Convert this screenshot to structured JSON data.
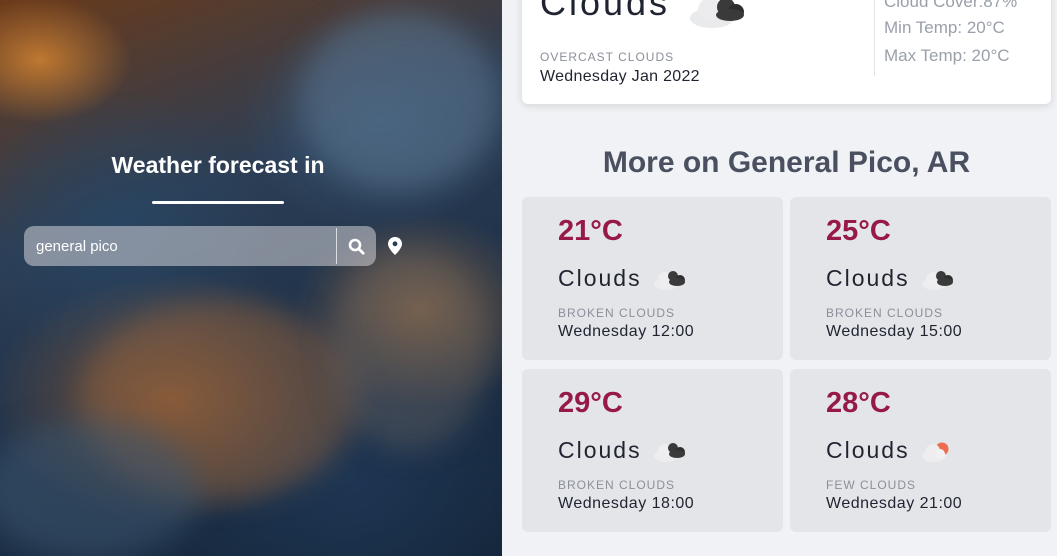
{
  "hero": {
    "title": "Weather forecast in",
    "search_value": "general pico"
  },
  "current": {
    "condition": "Clouds",
    "description": "OVERCAST CLOUDS",
    "date": "Wednesday Jan 2022",
    "cloud_cover": "Cloud Cover:87%",
    "min_temp": "Min Temp: 20°C",
    "max_temp": "Max Temp: 20°C",
    "icon": "overcast-clouds-icon"
  },
  "section_title": "More on General Pico, AR",
  "forecast": [
    {
      "temp": "21°C",
      "condition": "Clouds",
      "description": "BROKEN CLOUDS",
      "time": "Wednesday 12:00",
      "icon": "broken-clouds-icon"
    },
    {
      "temp": "25°C",
      "condition": "Clouds",
      "description": "BROKEN CLOUDS",
      "time": "Wednesday 15:00",
      "icon": "broken-clouds-icon"
    },
    {
      "temp": "29°C",
      "condition": "Clouds",
      "description": "BROKEN CLOUDS",
      "time": "Wednesday 18:00",
      "icon": "broken-clouds-icon"
    },
    {
      "temp": "28°C",
      "condition": "Clouds",
      "description": "FEW CLOUDS",
      "time": "Wednesday 21:00",
      "icon": "few-clouds-icon"
    }
  ],
  "colors": {
    "accent_temp": "#96194a",
    "card_bg": "#e4e5e9",
    "page_bg": "#f0f2f5",
    "sun": "#ec6e4c"
  }
}
